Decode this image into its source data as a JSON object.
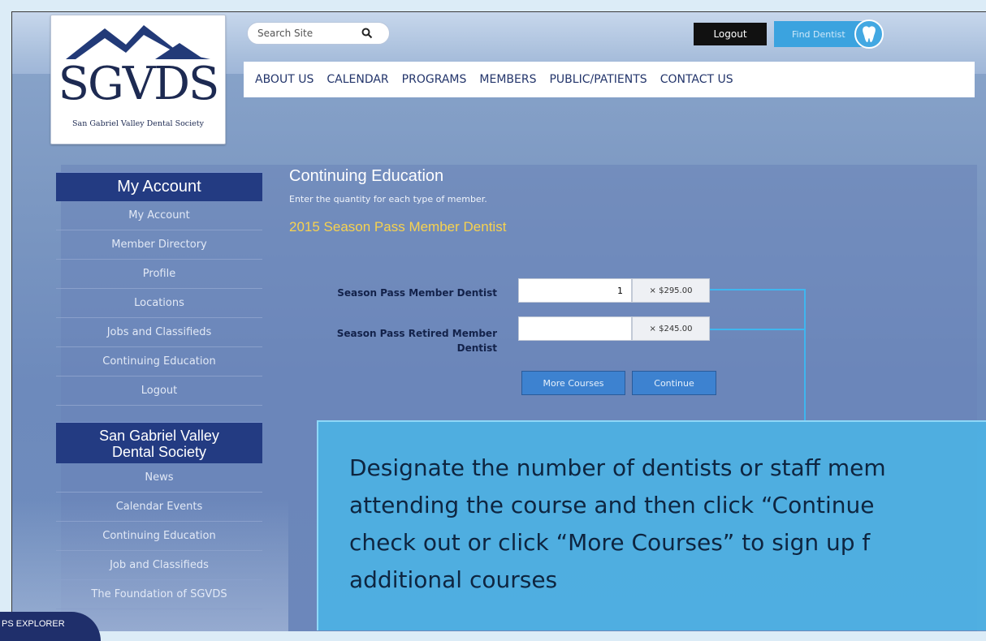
{
  "site": {
    "logo_text": "SGVDS",
    "logo_subtitle": "San Gabriel Valley Dental Society"
  },
  "search": {
    "placeholder": "Search Site",
    "icon": "search-icon"
  },
  "header": {
    "logout_label": "Logout",
    "find_dentist_label": "Find Dentist",
    "tooth_icon": "tooth-icon"
  },
  "nav": {
    "items": [
      {
        "label": "ABOUT US"
      },
      {
        "label": "CALENDAR"
      },
      {
        "label": "PROGRAMS"
      },
      {
        "label": "MEMBERS"
      },
      {
        "label": "PUBLIC/PATIENTS"
      },
      {
        "label": "CONTACT US"
      }
    ]
  },
  "sidebar": {
    "account_title": "My Account",
    "account_items": [
      {
        "label": "My Account"
      },
      {
        "label": "Member Directory"
      },
      {
        "label": "Profile"
      },
      {
        "label": "Locations"
      },
      {
        "label": "Jobs and Classifieds"
      },
      {
        "label": "Continuing Education"
      },
      {
        "label": "Logout"
      }
    ],
    "society_title_line1": "San Gabriel Valley",
    "society_title_line2": "Dental Society",
    "society_items": [
      {
        "label": "News"
      },
      {
        "label": "Calendar Events"
      },
      {
        "label": "Continuing Education"
      },
      {
        "label": "Job and Classifieds"
      },
      {
        "label": "The Foundation of SGVDS"
      }
    ]
  },
  "main": {
    "title": "Continuing Education",
    "instructions": "Enter the quantity for each type of member.",
    "section_title": "2015 Season Pass Member Dentist",
    "rows": [
      {
        "label": "Season Pass Member Dentist",
        "quantity": "1",
        "price": "× $295.00"
      },
      {
        "label_line1": "Season Pass Retired Member",
        "label_line2": "Dentist",
        "quantity": "",
        "price": "× $245.00"
      }
    ],
    "more_courses_label": "More Courses",
    "continue_label": "Continue"
  },
  "callout": {
    "lines": [
      "Designate the number of dentists or staff mem",
      "attending the course and then click “Continue",
      "check out or click “More Courses” to sign up f",
      "additional courses"
    ]
  },
  "badge": {
    "text": "PS EXPLORER"
  },
  "colors": {
    "accent_blue": "#3d82d0",
    "sidebar_header": "#233b82",
    "section_gold": "#f7d24f",
    "callout_bg": "#4ab4e6"
  }
}
